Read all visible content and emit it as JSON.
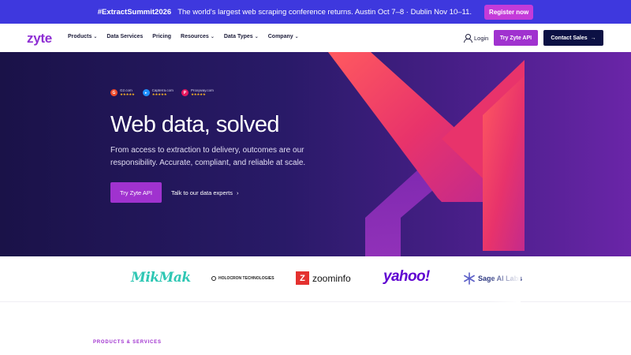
{
  "announcement": {
    "hashtag": "#ExtractSummit2026",
    "text": "The world's largest web scraping conference returns. Austin Oct 7–8 · Dublin Nov 10–11.",
    "cta": "Register now"
  },
  "nav": {
    "logo": "zyte",
    "menu": [
      {
        "label": "Products",
        "dropdown": true
      },
      {
        "label": "Data Services",
        "dropdown": false
      },
      {
        "label": "Pricing",
        "dropdown": false
      },
      {
        "label": "Resources",
        "dropdown": true
      },
      {
        "label": "Data Types",
        "dropdown": true
      },
      {
        "label": "Company",
        "dropdown": true
      }
    ],
    "login": "Login",
    "try_api": "Try Zyte API",
    "contact": "Contact Sales"
  },
  "hero": {
    "reviews": [
      {
        "name": "G2.com",
        "stars": "★★★★★",
        "icon": "g2-icon",
        "color": "#ef4a2b"
      },
      {
        "name": "Capterra.com",
        "stars": "★★★★★",
        "icon": "capterra-icon",
        "color": "#1e90ff"
      },
      {
        "name": "Proxyway.com",
        "stars": "★★★★★",
        "icon": "proxyway-icon",
        "color": "#e5195f"
      }
    ],
    "title": "Web data, solved",
    "subtitle": "From access to extraction to delivery, outcomes are our responsibility. Accurate, compliant, and reliable at scale.",
    "primary_cta": "Try Zyte API",
    "secondary_cta": "Talk to our data experts"
  },
  "logos": {
    "mikmak": "MikMak",
    "holocron": "HOLOCRON TECHNOLOGIES",
    "zoominfo": "zoominfo",
    "zoominfo_mark": "Z",
    "yahoo": "yahoo!",
    "sageai": "Sage AI Labs"
  },
  "section": {
    "label": "PRODUCTS & SERVICES"
  },
  "colors": {
    "announce_bg": "#3e38de",
    "brand_purple": "#a032cf",
    "navy": "#0c1144",
    "hero_pink": "#e8336b"
  }
}
